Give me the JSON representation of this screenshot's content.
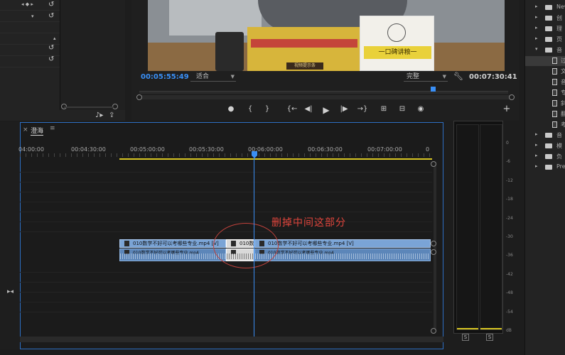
{
  "monitor": {
    "current_timecode": "00:05:55:49",
    "fit_option": "适合",
    "quality_option": "完整",
    "duration_timecode": "00:07:30:41",
    "video_card_text": "一口碑讲粮一",
    "video_label_text": "视频提示条",
    "transport": {
      "marker": "●",
      "in_point": "{",
      "out_point": "}",
      "go_in": "{←",
      "step_back": "◀|",
      "play": "▶",
      "step_fwd": "|▶",
      "go_out": "→}",
      "lift": "⊞",
      "extract": "⊟",
      "export_frame": "◉",
      "add": "+"
    }
  },
  "timeline": {
    "tab_label": "澄海",
    "tab_close": "×",
    "tab_menu": "≡",
    "ruler_ticks": [
      "04:00:00",
      "00:04:30:00",
      "00:05:00:00",
      "00:05:30:00",
      "00:06:00:00",
      "00:06:30:00",
      "00:07:00:00",
      "0"
    ],
    "clip_left_title": "010数学不好可以考哪些专业.mp4 [V]",
    "clip_mid_title": "010数",
    "clip_right_title": "010数学不好可以考哪些专业.mp4 [V]",
    "clip_audio_title": "010数学不好可以考哪些专业.mp4",
    "annotation": "删掉中间这部分"
  },
  "project": {
    "items": [
      {
        "label": "New",
        "kind": "folder"
      },
      {
        "label": "创",
        "kind": "folder"
      },
      {
        "label": "理",
        "kind": "folder"
      },
      {
        "label": "页",
        "kind": "folder"
      },
      {
        "label": "音",
        "kind": "folder"
      },
      {
        "label": "过",
        "kind": "file"
      },
      {
        "label": "文",
        "kind": "file"
      },
      {
        "label": "音",
        "kind": "file"
      },
      {
        "label": "专",
        "kind": "file"
      },
      {
        "label": "斜",
        "kind": "file"
      },
      {
        "label": "翻",
        "kind": "file"
      },
      {
        "label": "考",
        "kind": "file"
      },
      {
        "label": "音",
        "kind": "folder"
      },
      {
        "label": "模",
        "kind": "folder"
      },
      {
        "label": "负",
        "kind": "folder"
      },
      {
        "label": "Prese",
        "kind": "folder"
      }
    ]
  },
  "meters": {
    "db_labels": [
      "0",
      "-6",
      "-12",
      "-18",
      "-24",
      "-30",
      "-36",
      "-42",
      "-48",
      "-54",
      "dB"
    ],
    "solo_label": "S"
  },
  "colors": {
    "accent_blue": "#3a8ff5",
    "work_area_yellow": "#d8c623",
    "annotation_red": "#e0453c",
    "clip_blue": "#7aa4d6"
  }
}
